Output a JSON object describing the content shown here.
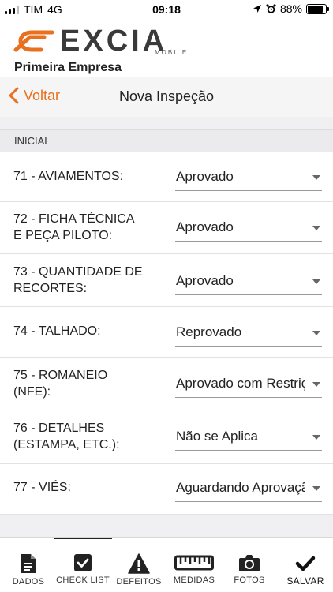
{
  "status": {
    "carrier": "TIM",
    "network": "4G",
    "time": "09:18",
    "battery": "88%",
    "battery_level": 0.88
  },
  "header": {
    "logo_text": "EXCIA",
    "logo_sub": "MOBILE",
    "company": "Primeira Empresa"
  },
  "nav": {
    "back_label": "Voltar",
    "title": "Nova Inspeção"
  },
  "section": {
    "title": "INICIAL"
  },
  "items": [
    {
      "label_lines": [
        "71 - AVIAMENTOS:"
      ],
      "value": "Aprovado"
    },
    {
      "label_lines": [
        "72 - FICHA TÉCNICA",
        "E PEÇA PILOTO:"
      ],
      "value": "Aprovado"
    },
    {
      "label_lines": [
        "73 - QUANTIDADE DE",
        "RECORTES:"
      ],
      "value": "Aprovado"
    },
    {
      "label_lines": [
        "74 - TALHADO:"
      ],
      "value": "Reprovado"
    },
    {
      "label_lines": [
        "75 - ROMANEIO",
        "(NFE):"
      ],
      "value": "Aprovado com Restrições"
    },
    {
      "label_lines": [
        "76 - DETALHES",
        "(ESTAMPA, ETC.):"
      ],
      "value": "Não se Aplica"
    },
    {
      "label_lines": [
        "77 - VIÉS:"
      ],
      "value": "Aguardando Aprovação"
    }
  ],
  "tabs": [
    {
      "id": "dados",
      "label": "DADOS",
      "icon": "document-icon"
    },
    {
      "id": "checklist",
      "label": "CHECK LIST",
      "icon": "checkbox-icon"
    },
    {
      "id": "defeitos",
      "label": "DEFEITOS",
      "icon": "warning-icon"
    },
    {
      "id": "medidas",
      "label": "MEDIDAS",
      "icon": "ruler-icon"
    },
    {
      "id": "fotos",
      "label": "FOTOS",
      "icon": "camera-icon"
    },
    {
      "id": "salvar",
      "label": "SALVAR",
      "icon": "checkmark-icon"
    }
  ],
  "colors": {
    "accent": "#e8701e",
    "logo_gray": "#3a3a3a"
  }
}
